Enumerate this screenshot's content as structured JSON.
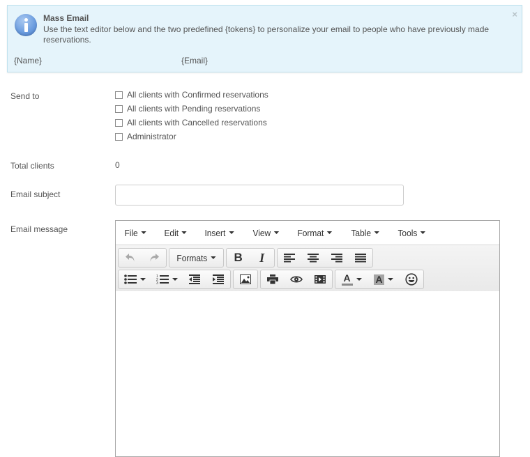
{
  "notice": {
    "title": "Mass Email",
    "description": "Use the text editor below and the two predefined {tokens} to personalize your email to people who have previously made reservations.",
    "tokens": [
      "{Name}",
      "{Email}"
    ],
    "close_label": "×",
    "colors": {
      "background": "#e5f4fb",
      "border": "#bfe1ee"
    }
  },
  "form": {
    "send_to": {
      "label": "Send to",
      "options": [
        {
          "label": "All clients with Confirmed reservations",
          "checked": false
        },
        {
          "label": "All clients with Pending reservations",
          "checked": false
        },
        {
          "label": "All clients with Cancelled reservations",
          "checked": false
        },
        {
          "label": "Administrator",
          "checked": false
        }
      ]
    },
    "total_clients": {
      "label": "Total clients",
      "value": "0"
    },
    "email_subject": {
      "label": "Email subject",
      "value": "",
      "placeholder": ""
    },
    "email_message": {
      "label": "Email message"
    }
  },
  "editor": {
    "menus": [
      "File",
      "Edit",
      "Insert",
      "View",
      "Format",
      "Table",
      "Tools"
    ],
    "toolbar": {
      "formats_label": "Formats",
      "row1": [
        "undo-icon",
        "redo-icon",
        "formats-dropdown",
        "bold-icon",
        "italic-icon",
        "align-left-icon",
        "align-center-icon",
        "align-right-icon",
        "align-justify-icon"
      ],
      "row2": [
        "bullet-list-icon",
        "numbered-list-icon",
        "outdent-icon",
        "indent-icon",
        "image-icon",
        "print-icon",
        "preview-icon",
        "media-icon",
        "text-color-icon",
        "background-color-icon",
        "emoticons-icon"
      ],
      "bold_glyph": "B",
      "italic_glyph": "I",
      "text_color_glyph": "A",
      "bg_color_glyph": "A"
    },
    "content": ""
  }
}
